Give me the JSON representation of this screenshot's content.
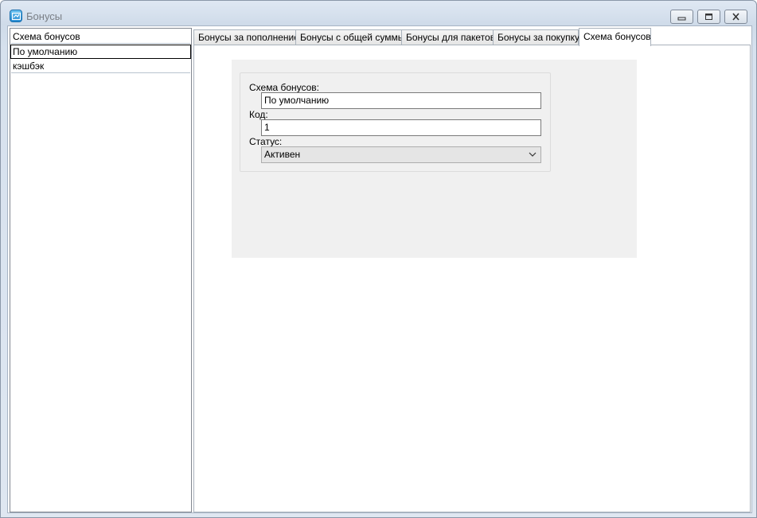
{
  "window": {
    "title": "Бонусы"
  },
  "list": {
    "header": "Схема бонусов",
    "items": [
      "По умолчанию",
      "кэшбэк"
    ]
  },
  "tabs": [
    {
      "label": "Бонусы за пополнение"
    },
    {
      "label": "Бонусы с общей суммы"
    },
    {
      "label": "Бонусы для пакетов"
    },
    {
      "label": "Бонусы за покупку"
    },
    {
      "label": "Схема бонусов"
    }
  ],
  "form": {
    "scheme_label": "Схема бонусов:",
    "scheme_value": "По умолчанию",
    "code_label": "Код:",
    "code_value": "1",
    "status_label": "Статус:",
    "status_value": "Активен"
  },
  "icons": {
    "app": "app-window-icon",
    "minimize": "minimize-icon",
    "maximize": "restore-icon",
    "close": "close-icon",
    "dropdown": "chevron-down-icon"
  }
}
